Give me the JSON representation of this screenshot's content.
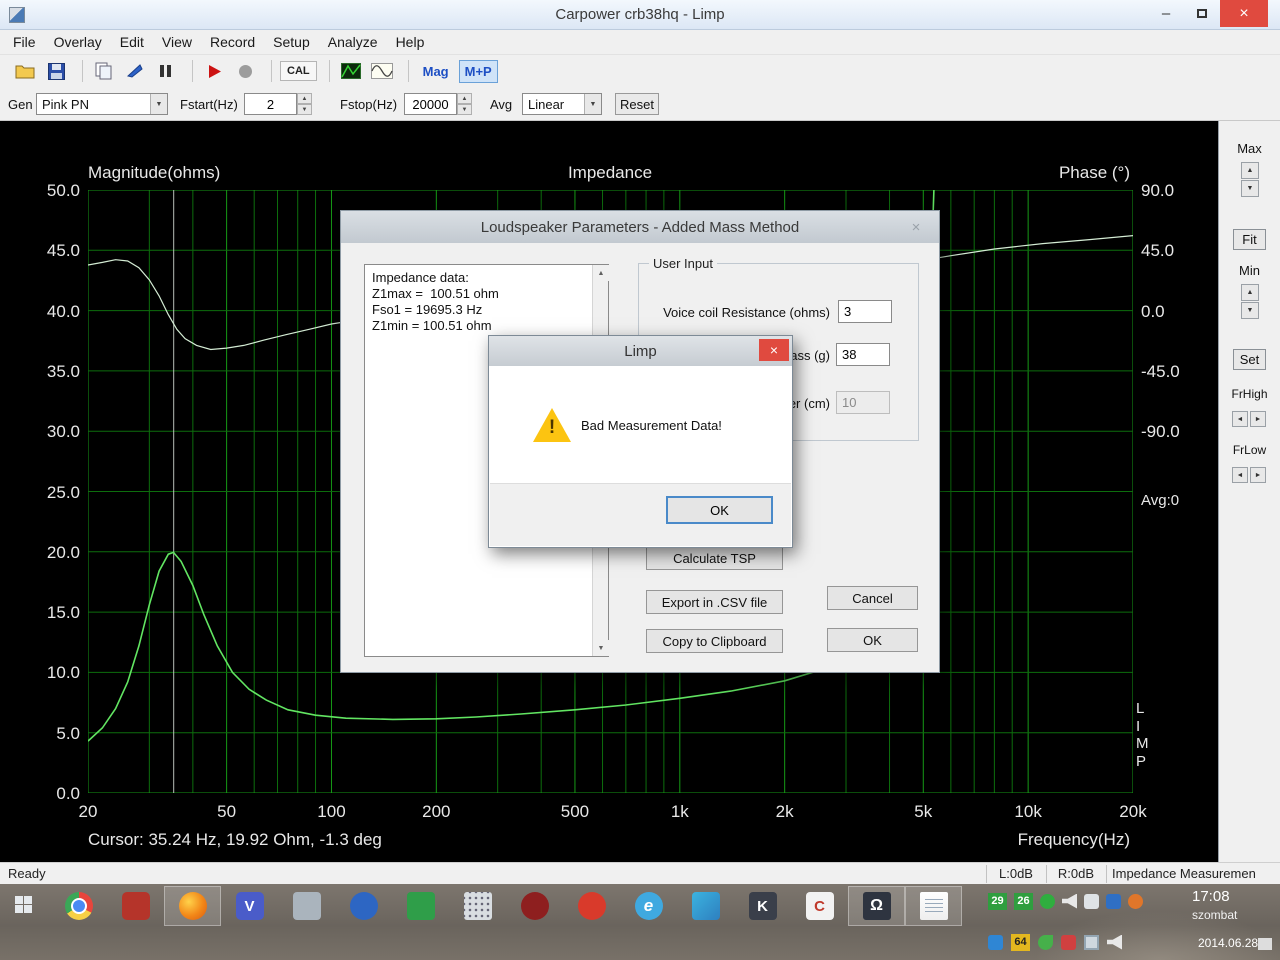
{
  "icons": {
    "close": "×",
    "min": "–",
    "up": "▲",
    "down": "▼",
    "left": "◄",
    "right": "►",
    "warning": "!"
  },
  "window": {
    "title": "Carpower crb38hq - Limp"
  },
  "menu": {
    "items": [
      "File",
      "Overlay",
      "Edit",
      "View",
      "Record",
      "Setup",
      "Analyze",
      "Help"
    ]
  },
  "toolbar": {
    "cal": "CAL",
    "mag": "Mag",
    "mp": "M+P"
  },
  "controls": {
    "gen_label": "Gen",
    "gen_value": "Pink PN",
    "fstart_label": "Fstart(Hz)",
    "fstart_value": "2",
    "fstop_label": "Fstop(Hz)",
    "fstop_value": "20000",
    "avg_label": "Avg",
    "avg_value": "Linear",
    "reset": "Reset"
  },
  "chart": {
    "left_title": "Magnitude(ohms)",
    "center_title": "Impedance",
    "right_title": "Phase (°)",
    "cursor_readout": "Cursor: 35.24 Hz, 19.92 Ohm, -1.3 deg",
    "x_axis_title": "Frequency(Hz)",
    "overlay_letters": [
      "L",
      "I",
      "M",
      "P"
    ],
    "avg_overlay": "Avg:0"
  },
  "chart_data": {
    "type": "line",
    "title": "Impedance",
    "bg": "#000000",
    "grid_color": "#0d6e0d",
    "major_grid_color": "#169a16",
    "x_axis": {
      "scale": "log",
      "min": 20,
      "max": 20000,
      "title": "Frequency(Hz)",
      "ticks": [
        {
          "f": 20,
          "label": "20"
        },
        {
          "f": 50,
          "label": "50"
        },
        {
          "f": 100,
          "label": "100"
        },
        {
          "f": 200,
          "label": "200"
        },
        {
          "f": 500,
          "label": "500"
        },
        {
          "f": 1000,
          "label": "1k"
        },
        {
          "f": 2000,
          "label": "2k"
        },
        {
          "f": 5000,
          "label": "5k"
        },
        {
          "f": 10000,
          "label": "10k"
        },
        {
          "f": 20000,
          "label": "20k"
        }
      ]
    },
    "y_left": {
      "title": "Magnitude(ohms)",
      "min": 0,
      "max": 50,
      "ticks": [
        "50.0",
        "45.0",
        "40.0",
        "35.0",
        "30.0",
        "25.0",
        "20.0",
        "15.0",
        "10.0",
        "5.0",
        "0.0"
      ]
    },
    "y_right": {
      "title": "Phase (°)",
      "top_deg": 90,
      "deg_per_tick": 45,
      "ticks": [
        "90.0",
        "45.0",
        "0.0",
        "-45.0",
        "-90.0"
      ]
    },
    "cursor": {
      "freq": 35.24,
      "magnitude_ohm": 19.92,
      "phase_deg": -1.3
    },
    "series": [
      {
        "name": "magnitude",
        "color": "#62e562",
        "points": [
          [
            20,
            4.3
          ],
          [
            22,
            5.4
          ],
          [
            24,
            7.0
          ],
          [
            26,
            9.2
          ],
          [
            28,
            12.2
          ],
          [
            30,
            15.6
          ],
          [
            32,
            18.4
          ],
          [
            34,
            19.8
          ],
          [
            35.2,
            19.95
          ],
          [
            37,
            19.2
          ],
          [
            40,
            17.2
          ],
          [
            43,
            14.8
          ],
          [
            47,
            12.2
          ],
          [
            52,
            10.0
          ],
          [
            58,
            8.6
          ],
          [
            65,
            7.7
          ],
          [
            75,
            6.9
          ],
          [
            90,
            6.45
          ],
          [
            110,
            6.2
          ],
          [
            150,
            6.1
          ],
          [
            200,
            6.15
          ],
          [
            260,
            6.3
          ],
          [
            350,
            6.55
          ],
          [
            500,
            6.9
          ],
          [
            700,
            7.3
          ],
          [
            1000,
            7.85
          ],
          [
            1400,
            8.45
          ],
          [
            2000,
            9.3
          ],
          [
            2600,
            10.3
          ],
          [
            3200,
            11.8
          ],
          [
            3800,
            14.0
          ],
          [
            4300,
            17.0
          ],
          [
            4700,
            22.0
          ],
          [
            5000,
            30.0
          ],
          [
            5250,
            42.0
          ],
          [
            5450,
            56.0
          ]
        ]
      },
      {
        "name": "phase",
        "color": "#d4ecd4",
        "points": [
          [
            20,
            34
          ],
          [
            22,
            36
          ],
          [
            24,
            38
          ],
          [
            26,
            37
          ],
          [
            28,
            32
          ],
          [
            30,
            23
          ],
          [
            32,
            11
          ],
          [
            34,
            -3
          ],
          [
            36,
            -14
          ],
          [
            38,
            -21
          ],
          [
            41,
            -26
          ],
          [
            45,
            -29
          ],
          [
            50,
            -28
          ],
          [
            56,
            -26
          ],
          [
            64,
            -22
          ],
          [
            74,
            -18
          ],
          [
            86,
            -14
          ],
          [
            100,
            -10
          ],
          [
            125,
            -6
          ],
          [
            160,
            -3
          ],
          [
            210,
            -1
          ],
          [
            280,
            2
          ],
          [
            380,
            4
          ],
          [
            520,
            7
          ],
          [
            700,
            9
          ],
          [
            950,
            12
          ],
          [
            1300,
            16
          ],
          [
            1800,
            20
          ],
          [
            2500,
            25
          ],
          [
            3400,
            30
          ],
          [
            4600,
            36
          ],
          [
            6000,
            41
          ],
          [
            8000,
            46
          ],
          [
            11000,
            50
          ],
          [
            15000,
            53
          ],
          [
            20000,
            56
          ]
        ]
      }
    ]
  },
  "side_panel": {
    "max": "Max",
    "fit": "Fit",
    "min": "Min",
    "set": "Set",
    "frhigh": "FrHigh",
    "frlow": "FrLow"
  },
  "params_dialog": {
    "title": "Loudspeaker Parameters - Added Mass Method",
    "impedance_text": [
      "Impedance data:",
      "Z1max =  100.51 ohm",
      "Fso1 = 19695.3 Hz",
      "Z1min = 100.51 ohm"
    ],
    "group": "User Input",
    "rows": [
      {
        "label": "Voice coil Resistance (ohms)",
        "value": "3"
      },
      {
        "label": "Added mass (g)",
        "value": "38"
      },
      {
        "label": "Membrane diameter (cm)",
        "value": "10"
      }
    ],
    "buttons": {
      "calc": "Calculate TSP",
      "export": "Export in .CSV file",
      "copy": "Copy to Clipboard",
      "cancel": "Cancel",
      "ok": "OK"
    }
  },
  "msgbox": {
    "title": "Limp",
    "message": "Bad Measurement Data!",
    "ok": "OK"
  },
  "statusbar": {
    "ready": "Ready",
    "l": "L:0dB",
    "r": "R:0dB",
    "mode": "Impedance Measuremen"
  },
  "taskbar": {
    "apps": [
      {
        "id": "chrome"
      },
      {
        "id": "mail"
      },
      {
        "id": "firefox",
        "active": true
      },
      {
        "id": "v-app",
        "glyph": "V"
      },
      {
        "id": "gray-app"
      },
      {
        "id": "thunderbird"
      },
      {
        "id": "green-app"
      },
      {
        "id": "keyboard"
      },
      {
        "id": "dark-red"
      },
      {
        "id": "red-swirl"
      },
      {
        "id": "ie",
        "glyph": "e"
      },
      {
        "id": "media"
      },
      {
        "id": "kmplayer",
        "glyph": "K"
      },
      {
        "id": "c-app",
        "glyph": "C"
      },
      {
        "id": "limp",
        "glyph": "Ω",
        "active": true
      },
      {
        "id": "notepad",
        "active": true
      }
    ],
    "tray1": [
      {
        "badge": "29"
      },
      {
        "badge": "26"
      },
      {
        "id": "tray-green"
      },
      {
        "id": "tray-speaker"
      },
      {
        "id": "tray-white"
      },
      {
        "id": "tray-blue"
      },
      {
        "id": "tray-orange"
      }
    ],
    "tray2": [
      {
        "id": "tray-key"
      },
      {
        "badge": "64",
        "yellow": true
      },
      {
        "id": "tray-leaf"
      },
      {
        "id": "tray-red"
      },
      {
        "id": "tray-display"
      },
      {
        "id": "tray-speaker2"
      }
    ],
    "clock": "17:08",
    "day": "szombat",
    "date": "2014.06.28."
  }
}
